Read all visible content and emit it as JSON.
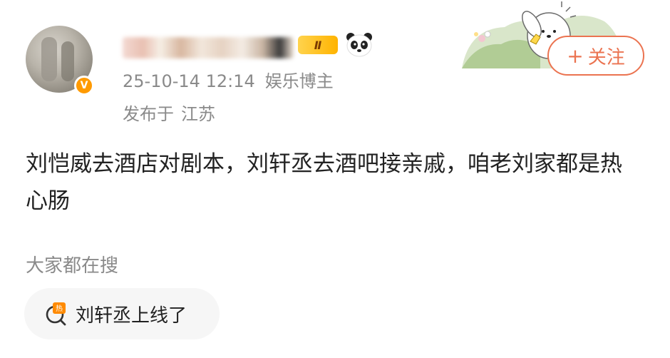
{
  "post": {
    "author": {
      "name": "",
      "verified": true,
      "level_badge": "Ⅱ"
    },
    "timestamp": "25-10-14 12:14",
    "role": "娱乐博主",
    "location_prefix": "发布于",
    "location": "江苏",
    "follow_label": "关注",
    "follow_plus": "+",
    "content": "刘恺威去酒店对剧本，刘轩丞去酒吧接亲戚，咱老刘家都是热心肠"
  },
  "search": {
    "title": "大家都在搜",
    "hot_items": [
      {
        "label": "刘轩丞上线了",
        "icon": "hot-search-icon"
      }
    ]
  },
  "colors": {
    "accent": "#eb7350",
    "verified": "#ff9a00",
    "meta": "#8a8a8a"
  },
  "icons": [
    "verified-v-icon",
    "level-badge-icon",
    "panda-icon",
    "pochacco-sticker",
    "plus-icon",
    "hot-search-icon"
  ]
}
